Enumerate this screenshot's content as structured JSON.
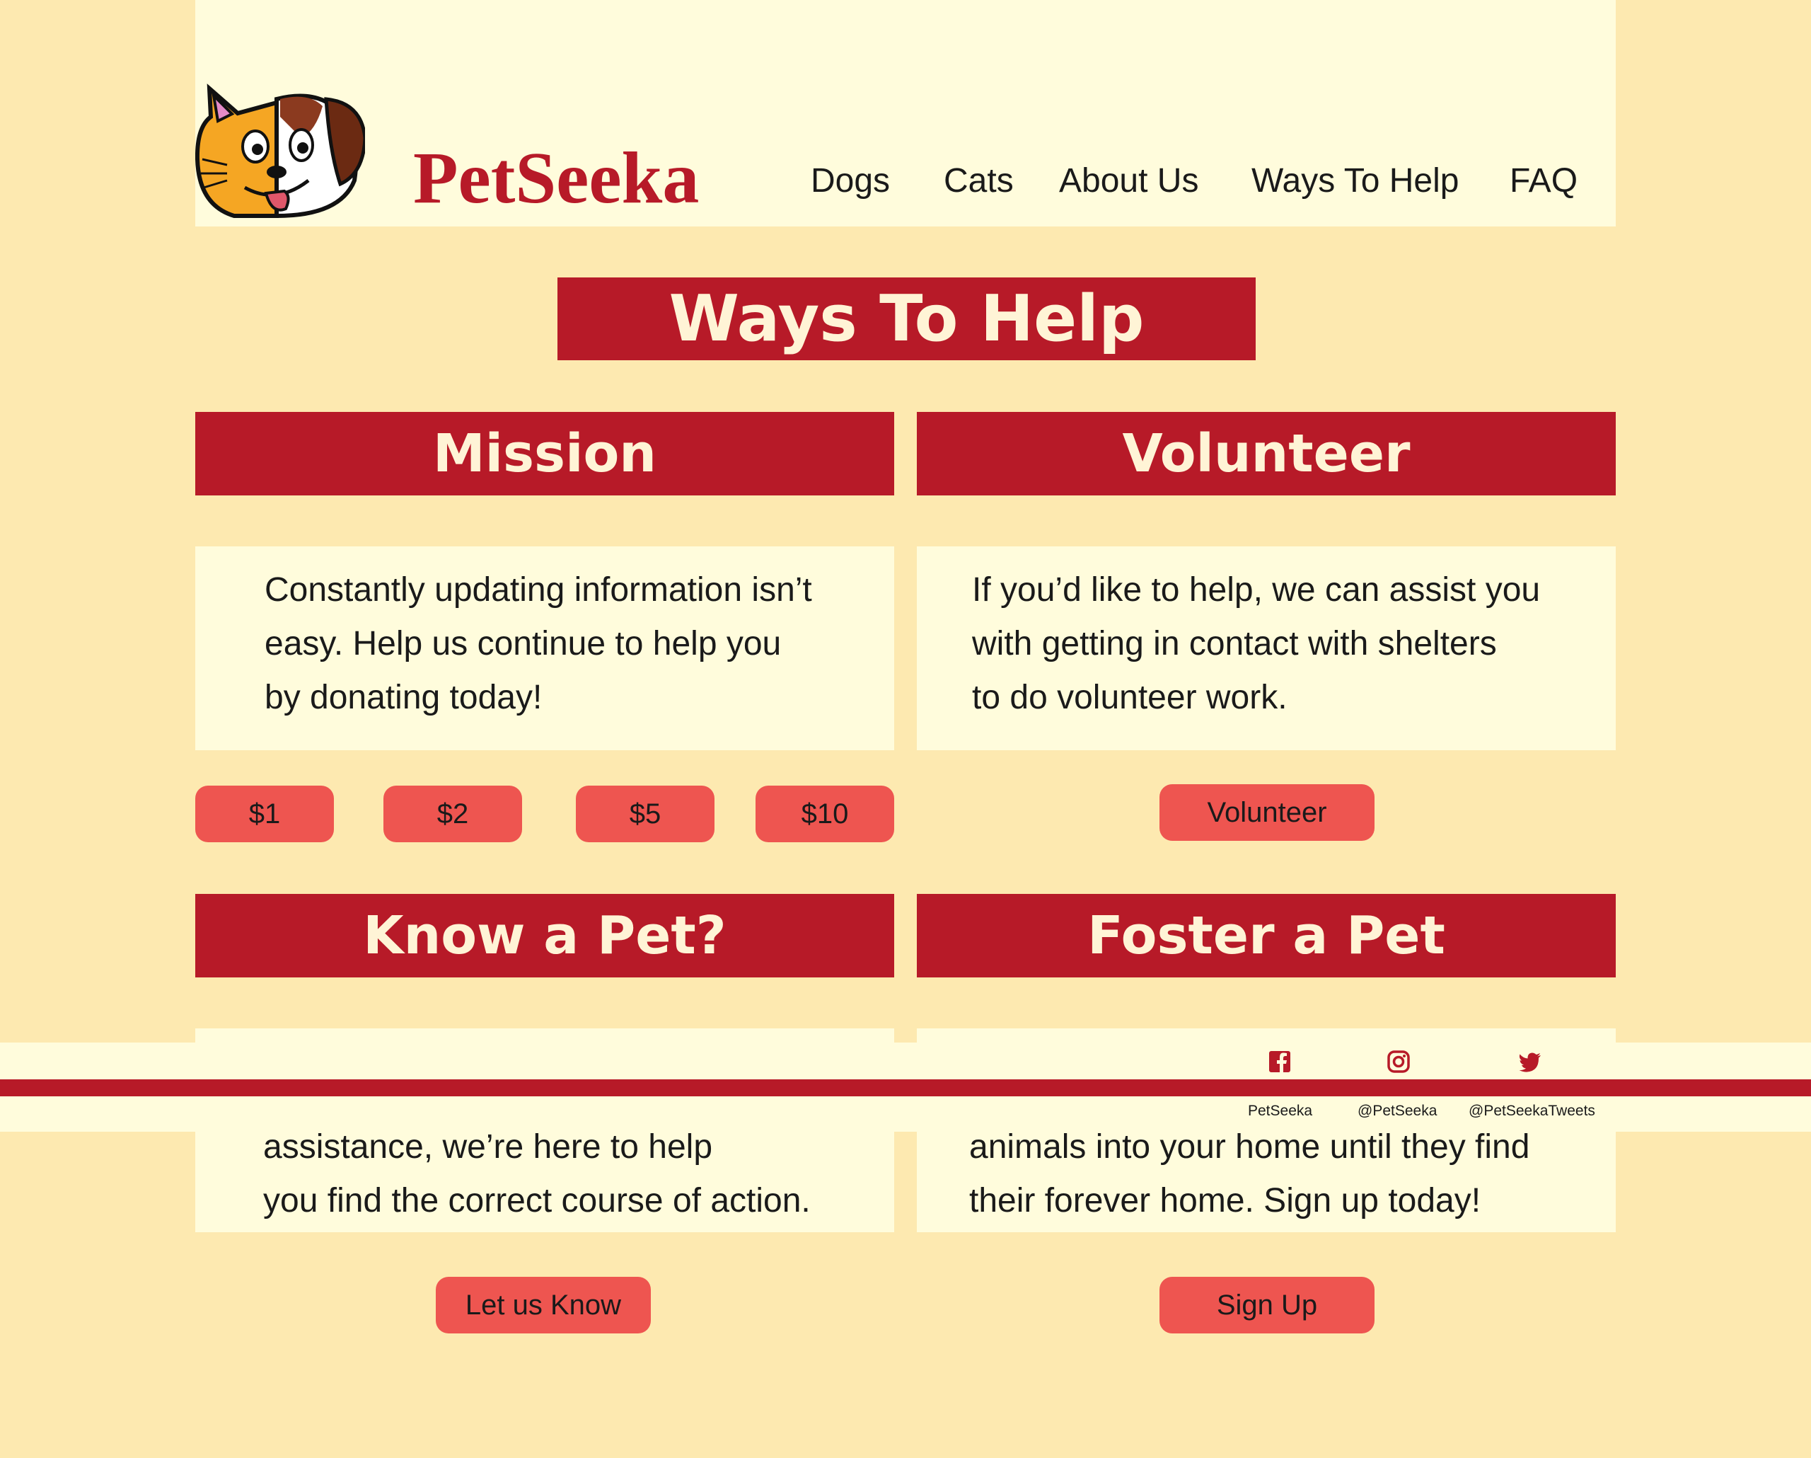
{
  "brand": {
    "name": "PetSeeka"
  },
  "nav": {
    "items": [
      {
        "label": "Dogs"
      },
      {
        "label": "Cats"
      },
      {
        "label": "About Us"
      },
      {
        "label": "Ways To Help"
      },
      {
        "label": "FAQ"
      }
    ]
  },
  "page": {
    "title": "Ways To Help"
  },
  "sections": {
    "mission": {
      "heading": "Mission",
      "lines": [
        "Constantly updating information isn’t",
        "easy. Help us continue to help you",
        "by donating today!"
      ],
      "buttons": [
        "$1",
        "$2",
        "$5",
        "$10"
      ]
    },
    "volunteer": {
      "heading": "Volunteer",
      "lines": [
        "If you’d like to help, we can assist you",
        "with getting in contact with shelters",
        "to do volunteer work."
      ],
      "button": "Volunteer"
    },
    "know_a_pet": {
      "heading": "Know a Pet?",
      "lines": [
        "assistance, we’re here to help",
        "you find the correct course of action."
      ],
      "button": "Let us Know"
    },
    "foster": {
      "heading": "Foster a Pet",
      "lines": [
        "animals into your home until they find",
        "their forever home. Sign up today!"
      ],
      "button": "Sign Up"
    }
  },
  "footer": {
    "social": [
      {
        "icon": "facebook-icon",
        "label": "PetSeeka"
      },
      {
        "icon": "instagram-icon",
        "label": "@PetSeeka"
      },
      {
        "icon": "twitter-icon",
        "label": "@PetSeekaTweets"
      }
    ]
  },
  "colors": {
    "page_bg": "#fde9b0",
    "panel_bg": "#fffcdc",
    "brand_red": "#b71a28",
    "button_coral": "#ee5550"
  }
}
